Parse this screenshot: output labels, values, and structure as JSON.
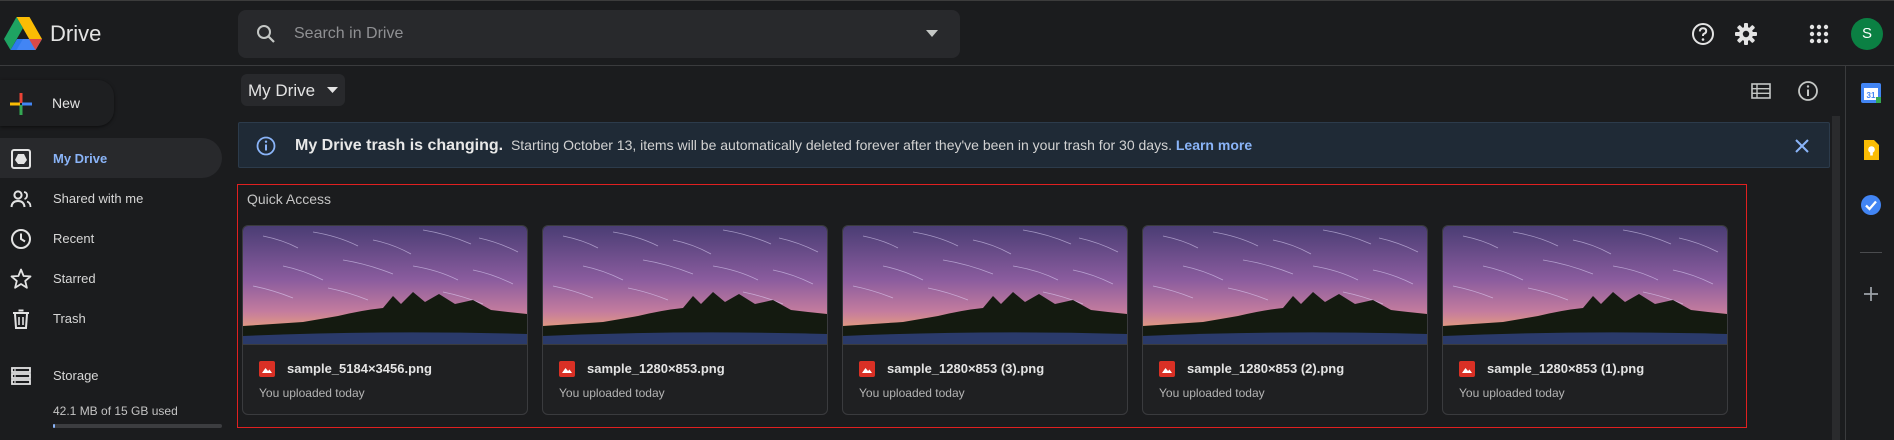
{
  "app": {
    "name": "Drive",
    "avatar_letter": "S",
    "avatar_color": "#0b8043"
  },
  "search": {
    "placeholder": "Search in Drive"
  },
  "header": {
    "icons": [
      "help-icon",
      "settings-icon",
      "apps-grid-icon"
    ]
  },
  "sidebar": {
    "new_label": "New",
    "items": [
      {
        "label": "My Drive",
        "icon": "my-drive-icon",
        "active": true
      },
      {
        "label": "Shared with me",
        "icon": "people-icon",
        "active": false
      },
      {
        "label": "Recent",
        "icon": "clock-icon",
        "active": false
      },
      {
        "label": "Starred",
        "icon": "star-icon",
        "active": false
      },
      {
        "label": "Trash",
        "icon": "trash-icon",
        "active": false
      },
      {
        "label": "Storage",
        "icon": "storage-icon",
        "active": false
      }
    ],
    "storage_used": "42.1 MB of 15 GB used",
    "storage_fraction": 0.003
  },
  "main": {
    "location_label": "My Drive",
    "banner": {
      "title": "My Drive trash is changing.",
      "message": "Starting October 13, items will be automatically deleted forever after they've been in your trash for 30 days.",
      "link": "Learn more"
    },
    "quick_access": {
      "title": "Quick Access",
      "files": [
        {
          "name": "sample_5184×3456.png",
          "subtitle": "You uploaded today"
        },
        {
          "name": "sample_1280×853.png",
          "subtitle": "You uploaded today"
        },
        {
          "name": "sample_1280×853 (3).png",
          "subtitle": "You uploaded today"
        },
        {
          "name": "sample_1280×853 (2).png",
          "subtitle": "You uploaded today"
        },
        {
          "name": "sample_1280×853 (1).png",
          "subtitle": "You uploaded today"
        }
      ]
    }
  },
  "side_panel": {
    "icons": [
      "calendar-icon",
      "keep-icon",
      "tasks-icon",
      "add-icon"
    ]
  },
  "colors": {
    "accent": "#8ab4f8",
    "background": "#1b1c1e",
    "highlight_frame": "#e02020"
  }
}
